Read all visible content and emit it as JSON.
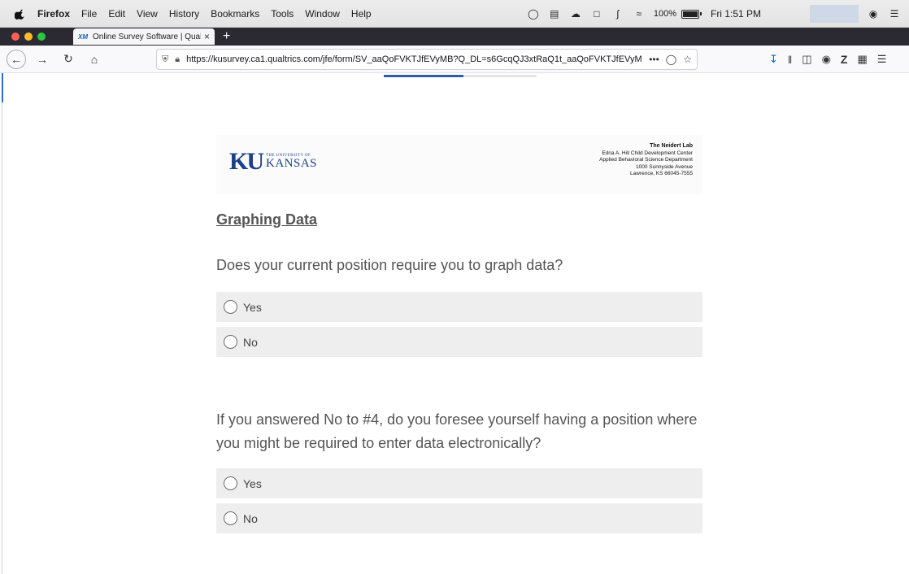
{
  "menubar": {
    "app": "Firefox",
    "items": [
      "File",
      "Edit",
      "View",
      "History",
      "Bookmarks",
      "Tools",
      "Window",
      "Help"
    ],
    "battery_text": "100%",
    "battery_level": 1.0,
    "clock": "Fri 1:51 PM",
    "icons": [
      "creative-cloud-icon",
      "display-icon",
      "wifi-icon",
      "bluetooth-icon",
      "siri-icon",
      "control-center-icon"
    ]
  },
  "browser": {
    "tab": {
      "favicon": "XM",
      "title": "Online Survey Software | Qualtr",
      "close": "×"
    },
    "new_tab": "+",
    "url_domain": "https://kusurvey.ca1.qualtrics.com",
    "url_path": "/jfe/form/SV_aaQoFVKTJfEVyMB?Q_DL=s6GcqQJ3xtRaQ1t_aaQoFVKTJfEVyM",
    "url_more": "•••"
  },
  "survey": {
    "progress": 0.52,
    "header": {
      "ku_mark": "KU",
      "ku_small": "THE UNIVERSITY OF",
      "ku_big": "KANSAS",
      "lab_name": "The Neidert Lab",
      "address_lines": [
        "Edna A. Hill Child Development Center",
        "Applied Behavioral Science Department",
        "1000 Sunnyside Avenue",
        "Lawrence, KS 66045-7555"
      ]
    },
    "section_title": "Graphing Data",
    "questions": [
      {
        "text": "Does your current position require you to graph data?",
        "choices": [
          "Yes",
          "No"
        ]
      },
      {
        "text": "If you answered No to #4, do you foresee yourself having a position where you might be required to enter data electronically?",
        "choices": [
          "Yes",
          "No"
        ]
      }
    ]
  },
  "colors": {
    "accent": "#2f5ea9",
    "ku_blue": "#1b3f8a",
    "choice_bg": "#eeeeee",
    "text_gray": "#555555"
  }
}
